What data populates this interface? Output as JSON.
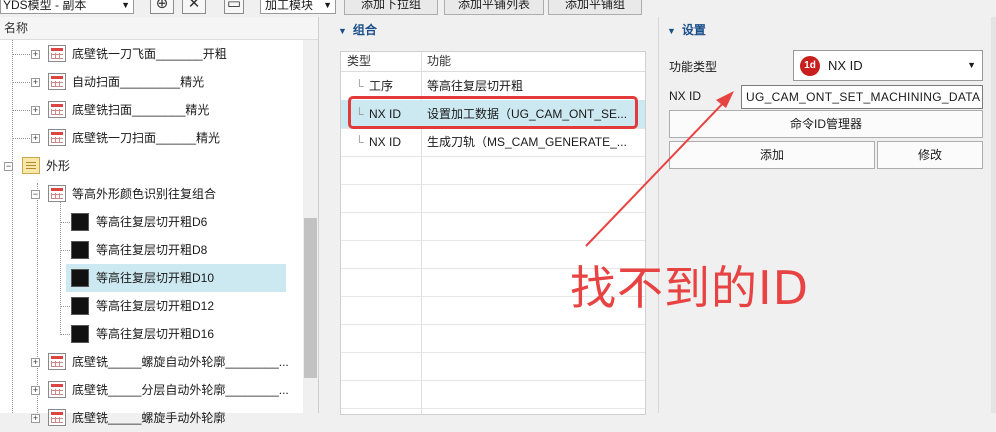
{
  "toolbar": {
    "template_combo": "YDS模型 - 副本",
    "module_combo": "加工模块",
    "buttons": [
      "添加下拉组",
      "添加平铺列表",
      "添加平铺组"
    ]
  },
  "tree": {
    "header": "名称",
    "items": [
      {
        "label": "底壁铣一刀飞面_______开粗"
      },
      {
        "label": "自动扫面_________精光"
      },
      {
        "label": "底壁铣扫面________精光"
      },
      {
        "label": "底壁铣一刀扫面______精光"
      },
      {
        "label": "外形"
      },
      {
        "label": "等高外形颜色识别往复组合"
      },
      {
        "label": "等高往复层切开粗D6"
      },
      {
        "label": "等高往复层切开粗D8"
      },
      {
        "label": "等高往复层切开粗D10"
      },
      {
        "label": "等高往复层切开粗D12"
      },
      {
        "label": "等高往复层切开粗D16"
      },
      {
        "label": "底壁铣_____螺旋自动外轮廓________..."
      },
      {
        "label": "底壁铣_____分层自动外轮廓________..."
      },
      {
        "label": "底壁铣_____螺旋手动外轮廓"
      }
    ]
  },
  "group_panel": {
    "title": "组合",
    "col_type": "类型",
    "col_func": "功能",
    "rows": [
      {
        "type": "工序",
        "func": "等高往复层切开粗"
      },
      {
        "type": "NX ID",
        "func": "设置加工数据（UG_CAM_ONT_SE..."
      },
      {
        "type": "NX ID",
        "func": "生成刀轨（MS_CAM_GENERATE_..."
      }
    ]
  },
  "settings": {
    "title": "设置",
    "func_type_label": "功能类型",
    "func_type_value": "NX ID",
    "nxid_label": "NX ID",
    "nxid_value": "UG_CAM_ONT_SET_MACHINING_DATA",
    "cmd_manager_button": "命令ID管理器",
    "add_button": "添加",
    "modify_button": "修改"
  },
  "annotation": {
    "text": "找不到的ID",
    "color": "#e84343"
  },
  "colors": {
    "accent": "#1b4f8a",
    "selection": "#cce8f0",
    "highlight": "#e23a3a",
    "nx_badge": "#c81e1e"
  }
}
